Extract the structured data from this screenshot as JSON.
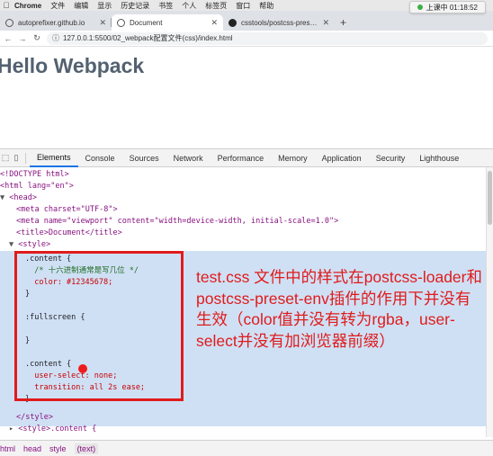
{
  "menubar": {
    "app": "Chrome",
    "items": [
      "文件",
      "编辑",
      "显示",
      "历史记录",
      "书签",
      "个人",
      "标签页",
      "窗口",
      "帮助"
    ],
    "clock": "上课中 01:18:52"
  },
  "tabs": [
    {
      "title": "autoprefixer.github.io",
      "active": false,
      "icon": "globe-icon"
    },
    {
      "title": "Document",
      "active": true,
      "icon": "globe-icon"
    },
    {
      "title": "csstools/postcss-preset-env: C…",
      "active": false,
      "icon": "github-icon"
    }
  ],
  "address": {
    "url": "127.0.0.1:5500/02_webpack配置文件(css)/index.html"
  },
  "page": {
    "title": "Hello Webpack"
  },
  "devtools": {
    "tabs": [
      "Elements",
      "Console",
      "Sources",
      "Network",
      "Performance",
      "Memory",
      "Application",
      "Security",
      "Lighthouse"
    ],
    "active_tab": "Elements",
    "breadcrumbs": [
      "html",
      "head",
      "style",
      "(text)"
    ]
  },
  "code": {
    "doctype": "<!DOCTYPE html>",
    "html_open": "<html lang=\"en\">",
    "head": "<head>",
    "meta_charset": "<meta charset=\"UTF-8\">",
    "meta_viewport": "<meta name=\"viewport\" content=\"width=device-width, initial-scale=1.0\">",
    "title": "<title>Document</title>",
    "style_open": "<style>",
    "css": [
      ".content {",
      "  /* 十六进制通常是写几位 */",
      "  color: #12345678;",
      "}",
      "",
      ":fullscreen {",
      "",
      "}",
      "",
      ".content {",
      "  user-select: none;",
      "  transition: all 2s ease;",
      "}"
    ],
    "style_close": "</style>",
    "style2_open": "<style>.content {"
  },
  "annotation": {
    "text": "test.css 文件中的样式在postcss-loader和 postcss-preset-env插件的作用下并没有生效（color值并没有转为rgba，user-select并没有加浏览器前缀）"
  },
  "colors": {
    "annotation_red": "#e01b1b",
    "selection_blue": "#cfe0f5",
    "devtools_active": "#1a73e8"
  }
}
